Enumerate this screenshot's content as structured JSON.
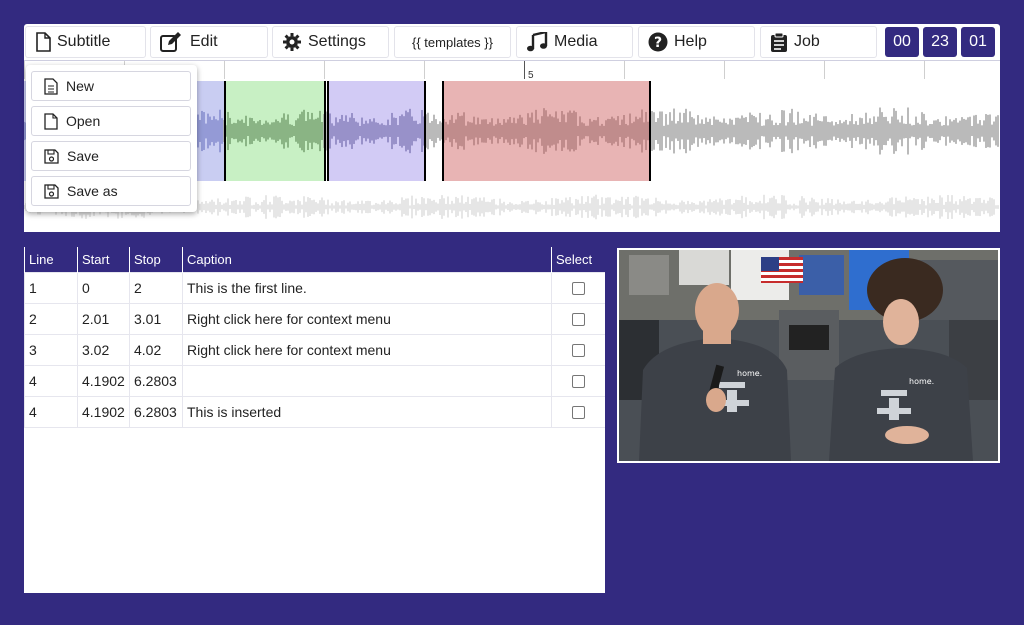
{
  "toolbar": {
    "subtitle": "Subtitle",
    "edit": "Edit",
    "settings": "Settings",
    "templates": "{{ templates }}",
    "media": "Media",
    "help": "Help",
    "job": "Job",
    "timer": [
      "00",
      "23",
      "01"
    ]
  },
  "timeline": {
    "ruler_label": "5"
  },
  "menu": {
    "new": "New",
    "open": "Open",
    "save": "Save",
    "save_as": "Save as"
  },
  "table": {
    "headers": [
      "Line",
      "Start",
      "Stop",
      "Caption",
      "Select"
    ],
    "rows": [
      {
        "line": "1",
        "start": "0",
        "stop": "2",
        "caption": "This is the first line.",
        "selected": false
      },
      {
        "line": "2",
        "start": "2.01",
        "stop": "3.01",
        "caption": "Right click here for context menu",
        "selected": false
      },
      {
        "line": "3",
        "start": "3.02",
        "stop": "4.02",
        "caption": "Right click here for context menu",
        "selected": false
      },
      {
        "line": "4",
        "start": "4.1902",
        "stop": "6.2803",
        "caption": "",
        "selected": false
      },
      {
        "line": "4",
        "start": "4.1902",
        "stop": "6.2803",
        "caption": "This is inserted",
        "selected": false
      }
    ]
  },
  "video": {
    "shirt_text_1": "home.",
    "shirt_text_2": "home."
  },
  "colors": {
    "brand": "#332a80",
    "region_blue": "#c9cdf2",
    "region_green": "#c8f0c4",
    "region_purple": "#d2cbf5",
    "region_red": "#e8b4b4"
  }
}
